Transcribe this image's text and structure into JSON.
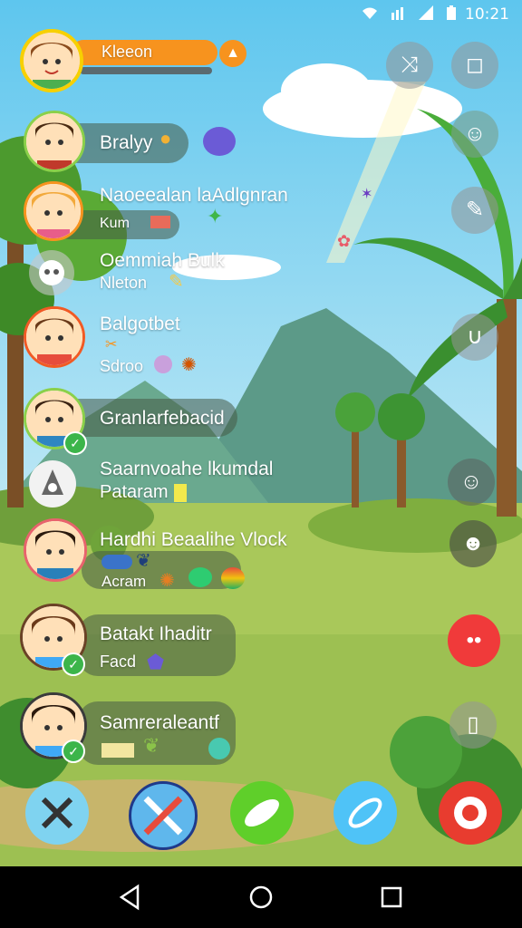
{
  "status_bar": {
    "time": "10:21"
  },
  "player": {
    "name": "Kleeon"
  },
  "players": [
    {
      "name": "Bralyy",
      "sub": ""
    },
    {
      "name": "Naoeealan laAdlgnran",
      "sub": "Kum"
    },
    {
      "name": "Oemmiah Bulk",
      "sub": "Nleton"
    },
    {
      "name": "Balgotbet",
      "sub": "Sdroo"
    },
    {
      "name": "Granlarfebacid",
      "sub": ""
    },
    {
      "name": "Saarnvoahe lkumdal",
      "sub": "Pataram"
    },
    {
      "name": "Hardhi Beaalihe Vlock",
      "sub": "Acram"
    },
    {
      "name": "Batakt Ihaditr",
      "sub": "Facd"
    },
    {
      "name": "Samreraleantf",
      "sub": ""
    }
  ],
  "right_buttons": [
    "shuffle-icon",
    "square-icon",
    "face-icon",
    "tools-icon",
    "magnet-icon",
    "face-icon",
    "smile-icon",
    "record-icon",
    "square-icon"
  ],
  "bottom_bar": [
    "scissors-icon",
    "tools-icon",
    "leaf-icon",
    "feather-icon",
    "gear-icon"
  ],
  "colors": {
    "accent": "#f7931e",
    "record": "#f03a3a",
    "gear": "#e83c2f",
    "leaf": "#5fcf2a",
    "sky": "#8fd3ef"
  }
}
